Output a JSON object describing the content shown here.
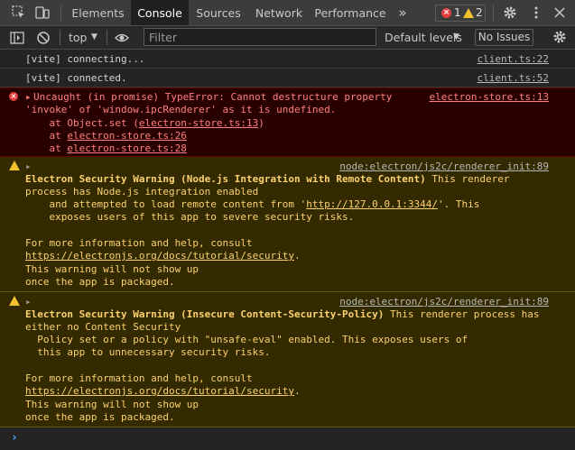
{
  "tabs": [
    {
      "label": "Elements"
    },
    {
      "label": "Console"
    },
    {
      "label": "Sources"
    },
    {
      "label": "Network"
    },
    {
      "label": "Performance"
    }
  ],
  "more_tabs_glyph": "»",
  "counts": {
    "errors": "1",
    "warnings": "2"
  },
  "toolbar": {
    "context": "top",
    "filter_placeholder": "Filter",
    "levels": "Default levels",
    "issues": "No Issues"
  },
  "messages": {
    "m1": {
      "text": "[vite] connecting...",
      "source": "client.ts:22"
    },
    "m2": {
      "text": "[vite] connected.",
      "source": "client.ts:52"
    },
    "m3": {
      "lines": [
        "Uncaught (in promise) TypeError: Cannot destructure property",
        "'invoke' of 'window.ipcRenderer' as it is undefined."
      ],
      "stack_prefix_1": "    at Object.set (",
      "stack_link_1": "electron-store.ts:13",
      "stack_suffix_1": ")",
      "stack_prefix_2": "    at ",
      "stack_link_2": "electron-store.ts:26",
      "stack_prefix_3": "    at ",
      "stack_link_3": "electron-store.ts:28",
      "source": "electron-store.ts:13"
    },
    "m4": {
      "source": "node:electron/js2c/renderer_init:89",
      "title": "Electron Security Warning (Node.js Integration with Remote Content)",
      "title_rest": " This renderer",
      "l2": "process has Node.js integration enabled",
      "l3_pre": "    and attempted to load remote content from '",
      "l3_link": "http://127.0.0.1:3344/",
      "l3_post": "'. This",
      "l4": "    exposes users of this app to severe security risks.",
      "l5": "For more information and help, consult",
      "l6_link": "https://electronjs.org/docs/tutorial/security",
      "l6_post": ".",
      "l7": "This warning will not show up",
      "l8": "once the app is packaged."
    },
    "m5": {
      "source": "node:electron/js2c/renderer_init:89",
      "title": "Electron Security Warning (Insecure Content-Security-Policy)",
      "title_rest": " This renderer process has",
      "l2": "either no Content Security",
      "l3": "  Policy set or a policy with \"unsafe-eval\" enabled. This exposes users of",
      "l4": "  this app to unnecessary security risks.",
      "l5": "For more information and help, consult",
      "l6_link": "https://electronjs.org/docs/tutorial/security",
      "l6_post": ".",
      "l7": "This warning will not show up",
      "l8": "once the app is packaged."
    }
  },
  "colors": {
    "error": "#ff8080",
    "warning": "#fcd170",
    "prompt": "#4da8ff"
  }
}
